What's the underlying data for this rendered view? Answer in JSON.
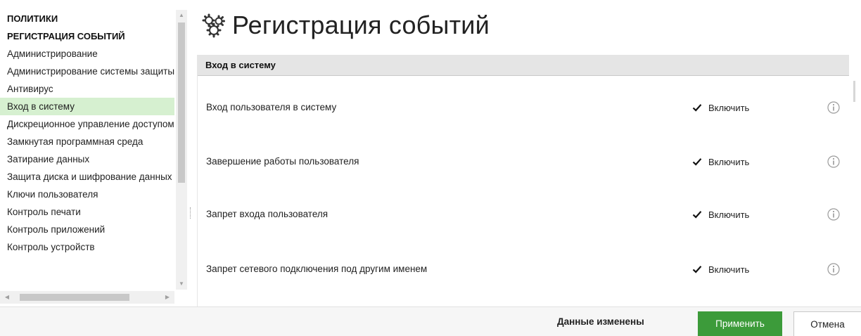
{
  "sidebar": {
    "headings": [
      "ПОЛИТИКИ",
      "РЕГИСТРАЦИЯ СОБЫТИЙ"
    ],
    "items": [
      {
        "label": "Администрирование"
      },
      {
        "label": "Администрирование системы защиты"
      },
      {
        "label": "Антивирус"
      },
      {
        "label": "Вход в систему",
        "selected": true
      },
      {
        "label": "Дискреционное управление доступом"
      },
      {
        "label": "Замкнутая программная среда"
      },
      {
        "label": "Затирание данных"
      },
      {
        "label": "Защита диска и шифрование данных"
      },
      {
        "label": "Ключи пользователя"
      },
      {
        "label": "Контроль печати"
      },
      {
        "label": "Контроль приложений"
      },
      {
        "label": "Контроль устройств"
      }
    ]
  },
  "main": {
    "title": "Регистрация событий",
    "title_icon": "gear-cluster-icon",
    "section": "Вход в систему",
    "rows": [
      {
        "label": "Вход пользователя в систему",
        "enabled": true,
        "check_label": "Включить"
      },
      {
        "label": "Завершение работы пользователя",
        "enabled": true,
        "check_label": "Включить"
      },
      {
        "label": "Запрет входа пользователя",
        "enabled": true,
        "check_label": "Включить"
      },
      {
        "label": "Запрет сетевого подключения под другим именем",
        "enabled": true,
        "check_label": "Включить"
      }
    ]
  },
  "footer": {
    "status": "Данные изменены",
    "apply_label": "Применить",
    "cancel_label": "Отмена"
  },
  "colors": {
    "selected_bg": "#d6f0d0",
    "apply_bg": "#3c9b3a",
    "section_bg": "#e5e5e5"
  }
}
